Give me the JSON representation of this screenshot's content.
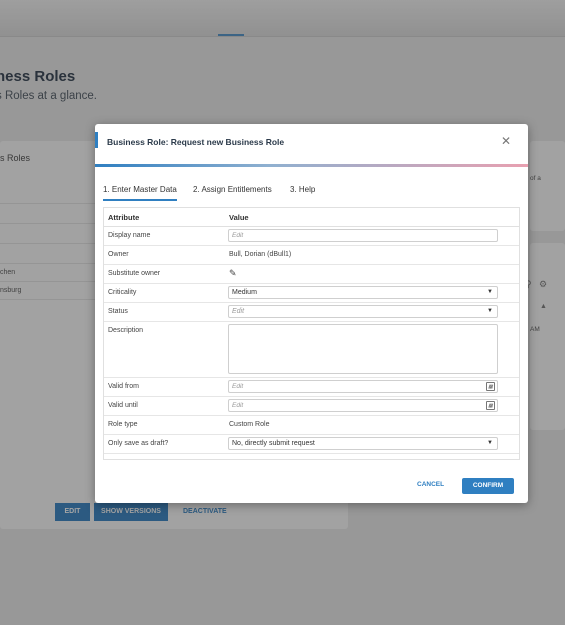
{
  "background": {
    "page_title": "ness Roles",
    "page_subtitle": "s Roles at a glance.",
    "card_title": "s Roles",
    "rows": [
      "chen",
      "nsburg"
    ],
    "buttons": {
      "edit": "EDIT",
      "show_versions": "SHOW VERSIONS",
      "deactivate": "DEACTIVATE"
    },
    "right_text": "of a",
    "right_am": "AM"
  },
  "dialog": {
    "title": "Business Role: Request new Business Role",
    "tabs": [
      "1. Enter Master Data",
      "2. Assign Entitlements",
      "3. Help"
    ],
    "columns": {
      "attribute": "Attribute",
      "value": "Value"
    },
    "fields": {
      "display_name": {
        "label": "Display name",
        "placeholder": "Edit"
      },
      "owner": {
        "label": "Owner",
        "value": "Bull, Dorian (dBull1)"
      },
      "substitute_owner": {
        "label": "Substitute owner"
      },
      "criticality": {
        "label": "Criticality",
        "value": "Medium"
      },
      "status": {
        "label": "Status",
        "placeholder": "Edit"
      },
      "description": {
        "label": "Description"
      },
      "valid_from": {
        "label": "Valid from",
        "placeholder": "Edit"
      },
      "valid_until": {
        "label": "Valid until",
        "placeholder": "Edit"
      },
      "role_type": {
        "label": "Role type",
        "value": "Custom Role"
      },
      "draft": {
        "label": "Only save as draft?",
        "value": "No, directly submit request"
      }
    },
    "cancel": "CANCEL",
    "confirm": "CONFIRM"
  },
  "colors": {
    "accent": "#2f7fc1"
  }
}
